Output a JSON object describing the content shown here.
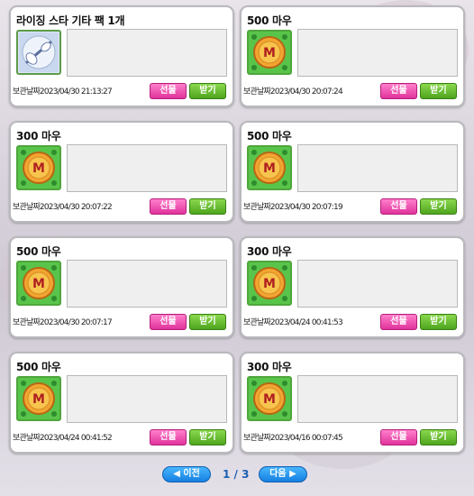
{
  "cards": [
    {
      "title": "라이징 스타 기타 팩 1개",
      "icon": "guitar-pack-icon",
      "date_label": "보관날짜",
      "date": "2023/04/30 21:13:27",
      "gift": "선물",
      "receive": "받기"
    },
    {
      "title": "500 마우",
      "icon": "mau-coin-icon",
      "date_label": "보관날짜",
      "date": "2023/04/30 20:07:24",
      "gift": "선물",
      "receive": "받기"
    },
    {
      "title": "300 마우",
      "icon": "mau-coin-icon",
      "date_label": "보관날짜",
      "date": "2023/04/30 20:07:22",
      "gift": "선물",
      "receive": "받기"
    },
    {
      "title": "500 마우",
      "icon": "mau-coin-icon",
      "date_label": "보관날짜",
      "date": "2023/04/30 20:07:19",
      "gift": "선물",
      "receive": "받기"
    },
    {
      "title": "500 마우",
      "icon": "mau-coin-icon",
      "date_label": "보관날짜",
      "date": "2023/04/30 20:07:17",
      "gift": "선물",
      "receive": "받기"
    },
    {
      "title": "300 마우",
      "icon": "mau-coin-icon",
      "date_label": "보관날짜",
      "date": "2023/04/24 00:41:53",
      "gift": "선물",
      "receive": "받기"
    },
    {
      "title": "500 마우",
      "icon": "mau-coin-icon",
      "date_label": "보관날짜",
      "date": "2023/04/24 00:41:52",
      "gift": "선물",
      "receive": "받기"
    },
    {
      "title": "300 마우",
      "icon": "mau-coin-icon",
      "date_label": "보관날짜",
      "date": "2023/04/16 00:07:45",
      "gift": "선물",
      "receive": "받기"
    }
  ],
  "pagination": {
    "prev": "◀ 이전",
    "current": "1",
    "separator": "/",
    "total": "3",
    "next": "다음 ▶"
  },
  "colors": {
    "gift": "#e0339c",
    "receive": "#4ea51e",
    "pager": "#1680e0",
    "page_text": "#1a5fb4"
  }
}
